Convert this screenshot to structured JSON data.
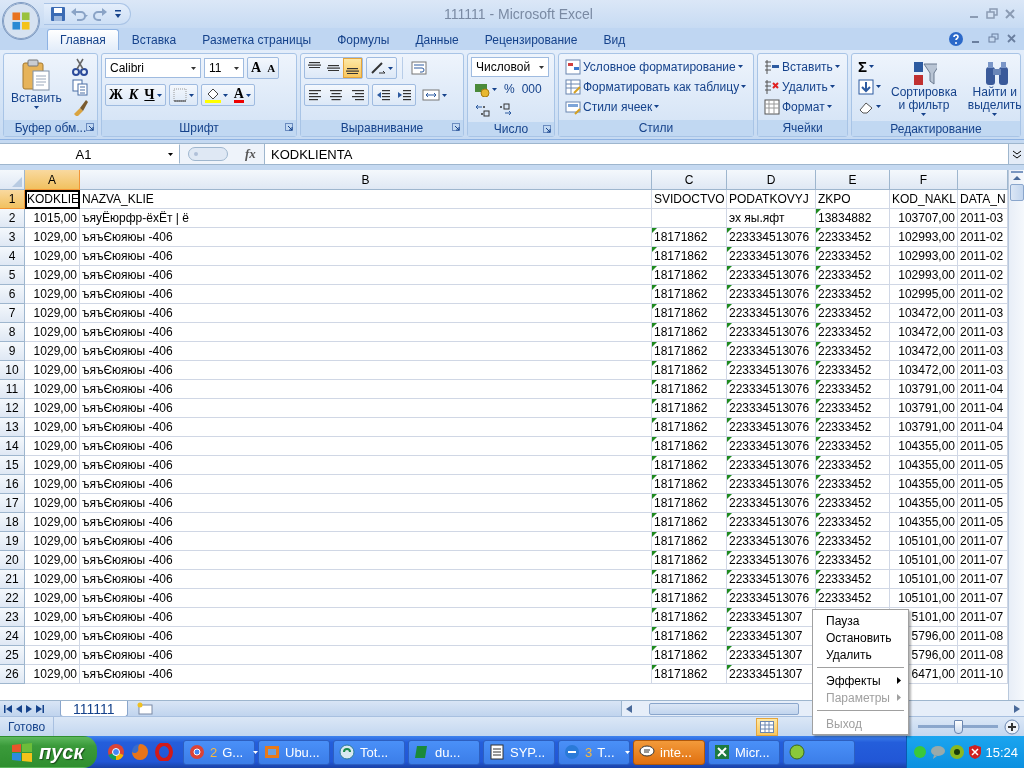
{
  "window": {
    "title": "111111 - Microsoft Excel"
  },
  "tabs": [
    {
      "label": "Главная",
      "selected": true
    },
    {
      "label": "Вставка",
      "selected": false
    },
    {
      "label": "Разметка страницы",
      "selected": false
    },
    {
      "label": "Формулы",
      "selected": false
    },
    {
      "label": "Данные",
      "selected": false
    },
    {
      "label": "Рецензирование",
      "selected": false
    },
    {
      "label": "Вид",
      "selected": false
    }
  ],
  "ribbon": {
    "clipboard": {
      "title": "Буфер обм...",
      "paste": "Вставить"
    },
    "font": {
      "title": "Шрифт",
      "font_name": "Calibri",
      "font_size": "11",
      "grow": "A",
      "shrink": "A",
      "bold": "Ж",
      "italic": "К",
      "underline": "Ч",
      "font_color": "A"
    },
    "alignment": {
      "title": "Выравнивание",
      "vertical": [
        {
          "selected": false
        },
        {
          "selected": false
        },
        {
          "selected": true
        }
      ]
    },
    "number": {
      "title": "Число",
      "format": "Числовой",
      "percent": "%",
      "thousands": "000"
    },
    "styles": {
      "title": "Стили",
      "buttons": [
        "Условное форматирование",
        "Форматировать как таблицу",
        "Стили ячеек"
      ]
    },
    "cells": {
      "title": "Ячейки",
      "buttons": [
        "Вставить",
        "Удалить",
        "Формат"
      ]
    },
    "editing": {
      "title": "Редактирование",
      "sum": "Σ",
      "sort": "Сортировка и фильтр",
      "find": "Найти и выделить"
    }
  },
  "formula_bar": {
    "name_box": "A1",
    "fx": "fx",
    "formula": "KODKLIENTA"
  },
  "sheet": {
    "columns": [
      "A",
      "B",
      "C",
      "D",
      "E",
      "F"
    ],
    "rows": [
      {
        "header": "1",
        "cells": [
          "KODKLIE",
          "NAZVA_KLIE",
          "SVIDOCTVO",
          "PODATKOVYJ",
          "ZKPO",
          "KOD_NAKL",
          "DATA_N"
        ],
        "marks": [
          false,
          false,
          false,
          false,
          false,
          false,
          false
        ]
      },
      {
        "header": "2",
        "cells": [
          "1015,00",
          "ъяуЁюрфр-ёхЁт | ё",
          null,
          "эх яы.яфт",
          "13834882",
          "103707,00",
          "2011-03"
        ],
        "marks": [
          false,
          false,
          false,
          false,
          true,
          false,
          false
        ]
      },
      {
        "header": "3",
        "cells": [
          "1029,00",
          "ъяъЄюяюы -406",
          "18171862",
          "223334513076",
          "22333452",
          "102993,00",
          "2011-02"
        ],
        "marks": [
          false,
          false,
          true,
          true,
          true,
          false,
          false
        ]
      },
      {
        "header": "4",
        "cells": [
          "1029,00",
          "ъяъЄюяюы -406",
          "18171862",
          "223334513076",
          "22333452",
          "102993,00",
          "2011-02"
        ],
        "marks": [
          false,
          false,
          true,
          true,
          true,
          false,
          false
        ]
      },
      {
        "header": "5",
        "cells": [
          "1029,00",
          "ъяъЄюяюы -406",
          "18171862",
          "223334513076",
          "22333452",
          "102993,00",
          "2011-02"
        ],
        "marks": [
          false,
          false,
          true,
          true,
          true,
          false,
          false
        ]
      },
      {
        "header": "6",
        "cells": [
          "1029,00",
          "ъяъЄюяюы -406",
          "18171862",
          "223334513076",
          "22333452",
          "102995,00",
          "2011-02"
        ],
        "marks": [
          false,
          false,
          true,
          true,
          true,
          false,
          false
        ]
      },
      {
        "header": "7",
        "cells": [
          "1029,00",
          "ъяъЄюяюы -406",
          "18171862",
          "223334513076",
          "22333452",
          "103472,00",
          "2011-03"
        ],
        "marks": [
          false,
          false,
          true,
          true,
          true,
          false,
          false
        ]
      },
      {
        "header": "8",
        "cells": [
          "1029,00",
          "ъяъЄюяюы -406",
          "18171862",
          "223334513076",
          "22333452",
          "103472,00",
          "2011-03"
        ],
        "marks": [
          false,
          false,
          true,
          true,
          true,
          false,
          false
        ]
      },
      {
        "header": "9",
        "cells": [
          "1029,00",
          "ъяъЄюяюы -406",
          "18171862",
          "223334513076",
          "22333452",
          "103472,00",
          "2011-03"
        ],
        "marks": [
          false,
          false,
          true,
          true,
          true,
          false,
          false
        ]
      },
      {
        "header": "10",
        "cells": [
          "1029,00",
          "ъяъЄюяюы -406",
          "18171862",
          "223334513076",
          "22333452",
          "103472,00",
          "2011-03"
        ],
        "marks": [
          false,
          false,
          true,
          true,
          true,
          false,
          false
        ]
      },
      {
        "header": "11",
        "cells": [
          "1029,00",
          "ъяъЄюяюы -406",
          "18171862",
          "223334513076",
          "22333452",
          "103791,00",
          "2011-04"
        ],
        "marks": [
          false,
          false,
          true,
          true,
          true,
          false,
          false
        ]
      },
      {
        "header": "12",
        "cells": [
          "1029,00",
          "ъяъЄюяюы -406",
          "18171862",
          "223334513076",
          "22333452",
          "103791,00",
          "2011-04"
        ],
        "marks": [
          false,
          false,
          true,
          true,
          true,
          false,
          false
        ]
      },
      {
        "header": "13",
        "cells": [
          "1029,00",
          "ъяъЄюяюы -406",
          "18171862",
          "223334513076",
          "22333452",
          "103791,00",
          "2011-04"
        ],
        "marks": [
          false,
          false,
          true,
          true,
          true,
          false,
          false
        ]
      },
      {
        "header": "14",
        "cells": [
          "1029,00",
          "ъяъЄюяюы -406",
          "18171862",
          "223334513076",
          "22333452",
          "104355,00",
          "2011-05"
        ],
        "marks": [
          false,
          false,
          true,
          true,
          true,
          false,
          false
        ]
      },
      {
        "header": "15",
        "cells": [
          "1029,00",
          "ъяъЄюяюы -406",
          "18171862",
          "223334513076",
          "22333452",
          "104355,00",
          "2011-05"
        ],
        "marks": [
          false,
          false,
          true,
          true,
          true,
          false,
          false
        ]
      },
      {
        "header": "16",
        "cells": [
          "1029,00",
          "ъяъЄюяюы -406",
          "18171862",
          "223334513076",
          "22333452",
          "104355,00",
          "2011-05"
        ],
        "marks": [
          false,
          false,
          true,
          true,
          true,
          false,
          false
        ]
      },
      {
        "header": "17",
        "cells": [
          "1029,00",
          "ъяъЄюяюы -406",
          "18171862",
          "223334513076",
          "22333452",
          "104355,00",
          "2011-05"
        ],
        "marks": [
          false,
          false,
          true,
          true,
          true,
          false,
          false
        ]
      },
      {
        "header": "18",
        "cells": [
          "1029,00",
          "ъяъЄюяюы -406",
          "18171862",
          "223334513076",
          "22333452",
          "104355,00",
          "2011-05"
        ],
        "marks": [
          false,
          false,
          true,
          true,
          true,
          false,
          false
        ]
      },
      {
        "header": "19",
        "cells": [
          "1029,00",
          "ъяъЄюяюы -406",
          "18171862",
          "223334513076",
          "22333452",
          "105101,00",
          "2011-07"
        ],
        "marks": [
          false,
          false,
          true,
          true,
          true,
          false,
          false
        ]
      },
      {
        "header": "20",
        "cells": [
          "1029,00",
          "ъяъЄюяюы -406",
          "18171862",
          "223334513076",
          "22333452",
          "105101,00",
          "2011-07"
        ],
        "marks": [
          false,
          false,
          true,
          true,
          true,
          false,
          false
        ]
      },
      {
        "header": "21",
        "cells": [
          "1029,00",
          "ъяъЄюяюы -406",
          "18171862",
          "223334513076",
          "22333452",
          "105101,00",
          "2011-07"
        ],
        "marks": [
          false,
          false,
          true,
          true,
          true,
          false,
          false
        ]
      },
      {
        "header": "22",
        "cells": [
          "1029,00",
          "ъяъЄюяюы -406",
          "18171862",
          "223334513076",
          "22333452",
          "105101,00",
          "2011-07"
        ],
        "marks": [
          false,
          false,
          true,
          true,
          true,
          false,
          false
        ]
      },
      {
        "header": "23",
        "cells": [
          "1029,00",
          "ъяъЄюяюы -406",
          "18171862",
          "22333451307",
          null,
          "5101,00",
          "2011-07"
        ],
        "marks": [
          false,
          false,
          true,
          true,
          false,
          false,
          false
        ]
      },
      {
        "header": "24",
        "cells": [
          "1029,00",
          "ъяъЄюяюы -406",
          "18171862",
          "22333451307",
          null,
          "5796,00",
          "2011-08"
        ],
        "marks": [
          false,
          false,
          true,
          true,
          false,
          false,
          false
        ]
      },
      {
        "header": "25",
        "cells": [
          "1029,00",
          "ъяъЄюяюы -406",
          "18171862",
          "22333451307",
          null,
          "5796,00",
          "2011-08"
        ],
        "marks": [
          false,
          false,
          true,
          true,
          false,
          false,
          false
        ]
      },
      {
        "header": "26",
        "cells": [
          "1029,00",
          "ъяъЄюяюы -406",
          "18171862",
          "22333451307",
          null,
          "6471,00",
          "2011-10"
        ],
        "marks": [
          false,
          false,
          true,
          true,
          false,
          false,
          false
        ]
      }
    ]
  },
  "sheet_tabs": [
    {
      "label": "111111",
      "selected": true
    }
  ],
  "status_bar": {
    "text": "Готово",
    "zoom": {
      "level": 0.5
    }
  },
  "taskbar": {
    "start": "пуск",
    "buttons": [
      {
        "count": "2",
        "label": "G...",
        "flashing": false
      },
      {
        "label": "Ubu...",
        "flashing": false
      },
      {
        "label": "Tot...",
        "flashing": false
      },
      {
        "label": "du...",
        "flashing": false
      },
      {
        "label": "SYP...",
        "flashing": false
      },
      {
        "count": "3",
        "label": "T...",
        "flashing": false
      },
      {
        "label": "inte...",
        "flashing": true
      },
      {
        "label": "Micr...",
        "flashing": false
      }
    ],
    "clock": "15:24"
  },
  "context_menu": {
    "items": [
      {
        "kind": "item",
        "label": "Пауза",
        "disabled": false
      },
      {
        "kind": "item",
        "label": "Остановить",
        "disabled": false
      },
      {
        "kind": "item",
        "label": "Удалить",
        "disabled": false
      },
      {
        "kind": "separator"
      },
      {
        "kind": "submenu",
        "label": "Эффекты",
        "disabled": false
      },
      {
        "kind": "submenu",
        "label": "Параметры",
        "disabled": true
      },
      {
        "kind": "separator"
      },
      {
        "kind": "item",
        "label": "Выход",
        "disabled": true
      }
    ]
  }
}
